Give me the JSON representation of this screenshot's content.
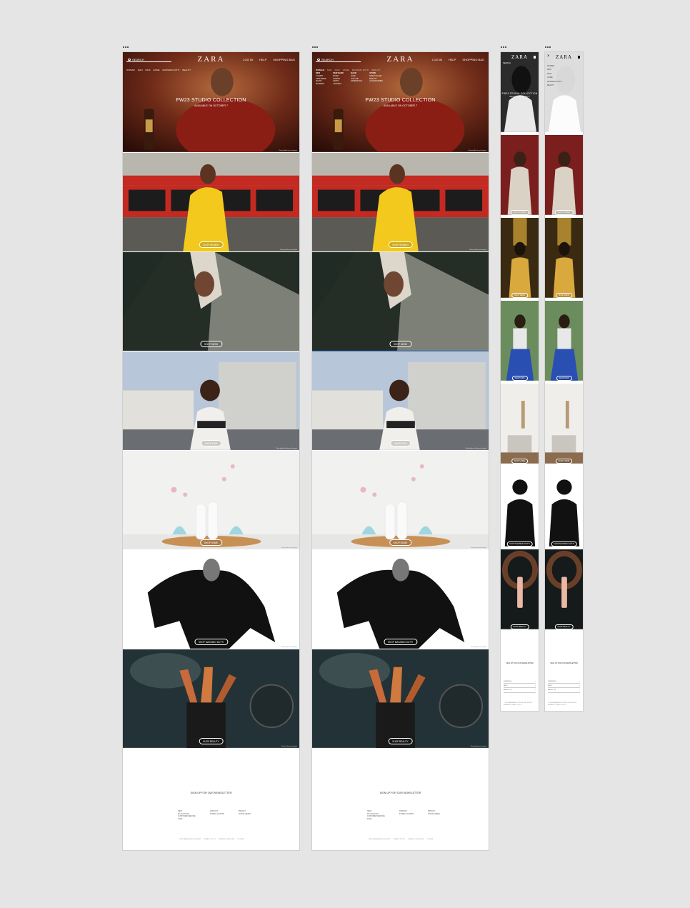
{
  "header": {
    "search_label": "SEARCH",
    "logo": "ZARA",
    "login": "LOG IN",
    "help": "HELP",
    "cart": "SHOPPING BAG",
    "nav": [
      "WOMAN",
      "MAN",
      "KIDS",
      "HOME",
      "MASSIMO DUTTI",
      "BEAUTY"
    ]
  },
  "mega_menu": [
    [
      "NEW",
      "T-SHIRT",
      "TROUSERS",
      "JEANS",
      "BLAZERS"
    ],
    [
      "NEW BASIC",
      "BASIC",
      "SHIRTS",
      "KNITS",
      "JACKETS"
    ],
    [
      "BASIC",
      "SALE",
      "COLLAB",
      "ESSENTIALS"
    ],
    [
      "STORE",
      "NEW COLLAB",
      "BEAUTY",
      "ACCESSORIES"
    ]
  ],
  "hero": {
    "title": "FW23 STUDIO COLLECTION",
    "subtitle": "AVAILABLE ON OCTOBER 7",
    "credit": "Photo by Mike Von on Unsplash"
  },
  "sections": [
    {
      "id": "women",
      "button": "SHOP WOMEN",
      "mobile_button": "SHOP WOMEN",
      "credit": "Photo by Nadine on Unsplash"
    },
    {
      "id": "men",
      "button": "SHOP MENS",
      "mobile_button": "SHOP MENS",
      "credit": ""
    },
    {
      "id": "kids",
      "button": "SHOP KIDS",
      "mobile_button": "SHOP KIDS",
      "credit": "Photo by Eye for Ebony on Unsplash"
    },
    {
      "id": "home",
      "button": "SHOP HOME",
      "mobile_button": "SHOP HOME",
      "credit": "Photo by Jana on Unsplash"
    },
    {
      "id": "massimo",
      "button": "SHOP MASSIMO DUTTI",
      "mobile_button": "SHOP MASSIMO DUTTI",
      "credit": "Photo by Jake on Unsplash"
    },
    {
      "id": "beauty",
      "button": "SHOP BEAUTY",
      "mobile_button": "SHOP BEAUTY",
      "credit": "Photo by Tyler on Unsplash"
    }
  ],
  "footer": {
    "newsletter": "SIGN UP FOR OUR NEWSLETTER",
    "col1": [
      "HELP",
      "MY ACCOUNT",
      "CUSTOMER SERVICE",
      "FAQS"
    ],
    "col2": [
      "CONTACT",
      "STORE LOCATOR"
    ],
    "col3": [
      "PRIVACY",
      "SOCIAL MEDIA"
    ],
    "legal": [
      "© 2023 ZARA FASHION CONCEPT",
      "PRIVACY POLICY",
      "TERMS & CONDITIONS",
      "COOKIES"
    ],
    "mobile_rows": [
      "TRENDING",
      "HELP",
      "ABOUT US"
    ],
    "mobile_legal": "© 2023 ZARA FASHION CONCEPT. ALL RIGHTS RESERVED. PRIVACY POLICY"
  },
  "mobile_menu": [
    "WOMEN",
    "MEN",
    "KIDS",
    "HOME",
    "MASSIMO DUTTI",
    "BEAUTY"
  ],
  "colors": {
    "selection": "#3a7bd5",
    "canvas": "#e5e5e5"
  }
}
